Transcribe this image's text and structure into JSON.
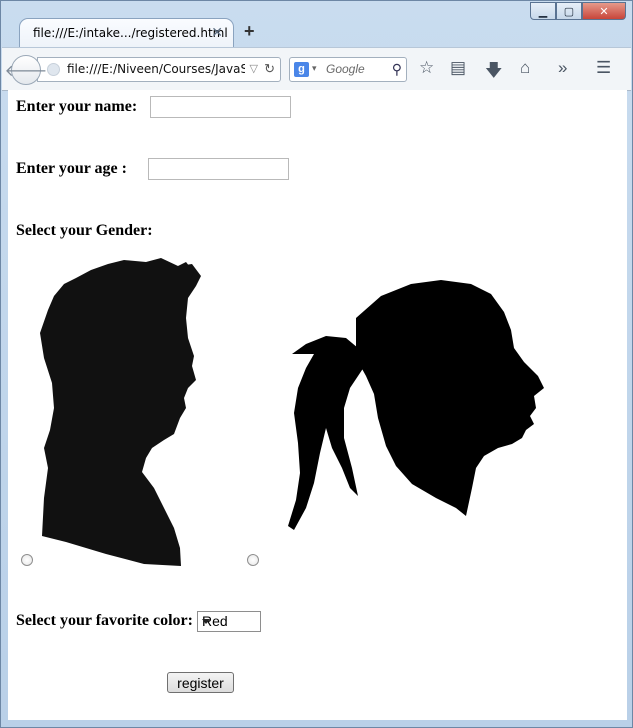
{
  "browser": {
    "tab_title": "file:///E:/intake.../registered.html",
    "address": "file:///E:/Niveen/Courses/JavaScri",
    "search_placeholder": "Google",
    "search_engine_letter": "g"
  },
  "form": {
    "name_label": "Enter your name:",
    "name_value": "",
    "age_label": "Enter your age :",
    "age_value": "",
    "gender_label": "Select your Gender:",
    "color_label": "Select your favorite color:",
    "color_selected": "Red",
    "register_label": "register"
  },
  "colors": {
    "silhouette": "#000000"
  }
}
